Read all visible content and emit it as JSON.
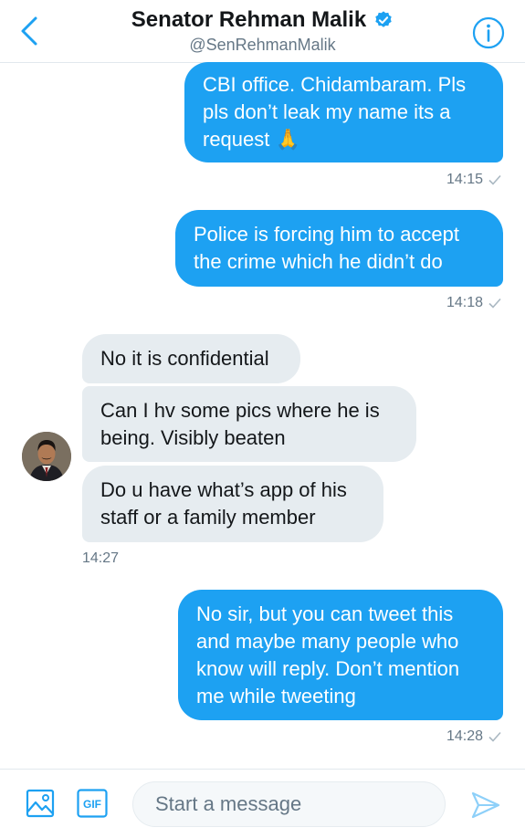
{
  "header": {
    "title": "Senator Rehman Malik",
    "handle": "@SenRehmanMalik"
  },
  "messages": [
    {
      "text": "CBI office. Chidambaram. Pls\npls don’t leak my name its a\nrequest 🙏"
    },
    {
      "text": "Police is forcing him to accept\nthe crime which he didn’t do"
    },
    {
      "text": "No it is confidential"
    },
    {
      "text": "Can I hv some pics where he is\nbeing. Visibly beaten"
    },
    {
      "text": "Do u have what’s app of his\nstaff or a family member"
    },
    {
      "text": "No sir, but you can tweet this\nand maybe many people who\nknow will reply. Don’t mention\nme while tweeting"
    }
  ],
  "timestamps": {
    "t1": "14:15",
    "t2": "14:18",
    "t3": "14:27",
    "t4": "14:28"
  },
  "composer": {
    "gif_label": "GIF",
    "placeholder": "Start a message"
  },
  "colors": {
    "accent": "#1da1f2",
    "incoming_bubble": "#e6ecf0",
    "muted_text": "#657786"
  }
}
